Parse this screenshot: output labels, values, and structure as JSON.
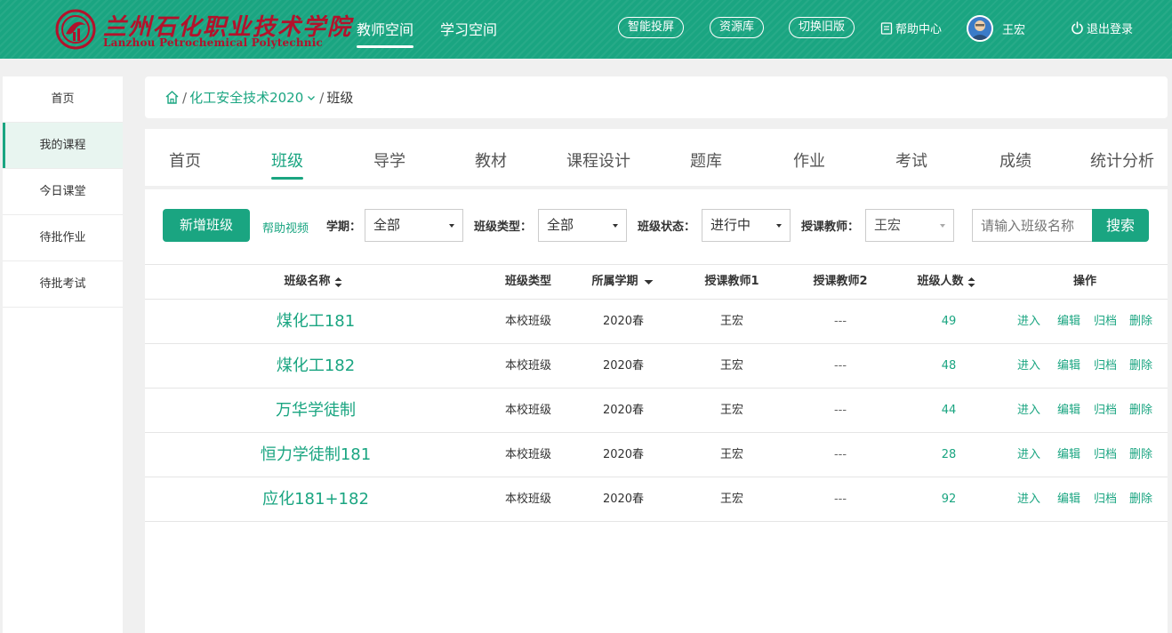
{
  "header": {
    "logo_cn": "兰州石化职业技术学院",
    "logo_en": "Lanzhou Petrochemical Polytechnic",
    "nav": [
      "教师空间",
      "学习空间"
    ],
    "active_nav": "教师空间",
    "pills": [
      "智能投屏",
      "资源库",
      "切换旧版"
    ],
    "help": "帮助中心",
    "user": "王宏",
    "logout": "退出登录",
    "colors": {
      "brand": "#1aa581",
      "logo": "#b3122b"
    }
  },
  "sidebar": {
    "items": [
      {
        "label": "首页"
      },
      {
        "label": "我的课程",
        "active": true
      },
      {
        "label": "今日课堂"
      },
      {
        "label": "待批作业"
      },
      {
        "label": "待批考试"
      }
    ]
  },
  "breadcrumb": {
    "course": "化工安全技术2020",
    "current": "班级"
  },
  "tabs": [
    "首页",
    "班级",
    "导学",
    "教材",
    "课程设计",
    "题库",
    "作业",
    "考试",
    "成绩",
    "统计分析"
  ],
  "active_tab": "班级",
  "toolbar": {
    "add_button": "新增班级",
    "help_video": "帮助视频",
    "term_label": "学期：",
    "term_value": "全部",
    "type_label": "班级类型：",
    "type_value": "全部",
    "status_label": "班级状态：",
    "status_value": "进行中",
    "teacher_label": "授课教师：",
    "teacher_value": "王宏",
    "search_placeholder": "请输入班级名称",
    "search_button": "搜索"
  },
  "table": {
    "headers": {
      "name": "班级名称",
      "type": "班级类型",
      "term": "所属学期",
      "teacher1": "授课教师1",
      "teacher2": "授课教师2",
      "count": "班级人数",
      "actions": "操作"
    },
    "rows": [
      {
        "name": "煤化工181",
        "type": "本校班级",
        "term": "2020春",
        "teacher1": "王宏",
        "teacher2": "---",
        "count": "49"
      },
      {
        "name": "煤化工182",
        "type": "本校班级",
        "term": "2020春",
        "teacher1": "王宏",
        "teacher2": "---",
        "count": "48"
      },
      {
        "name": "万华学徒制",
        "type": "本校班级",
        "term": "2020春",
        "teacher1": "王宏",
        "teacher2": "---",
        "count": "44"
      },
      {
        "name": "恒力学徒制181",
        "type": "本校班级",
        "term": "2020春",
        "teacher1": "王宏",
        "teacher2": "---",
        "count": "28"
      },
      {
        "name": "应化181+182",
        "type": "本校班级",
        "term": "2020春",
        "teacher1": "王宏",
        "teacher2": "---",
        "count": "92"
      }
    ],
    "actions": [
      "进入",
      "编辑",
      "归档",
      "删除"
    ]
  }
}
